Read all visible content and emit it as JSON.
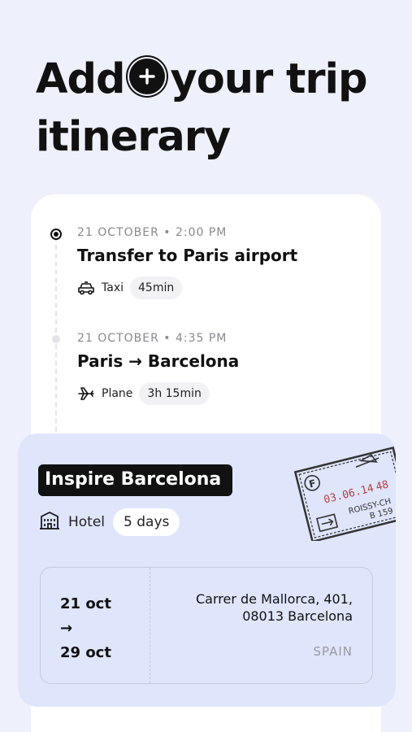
{
  "headline": {
    "line1_before": "Add",
    "line1_after": "your trip",
    "line2": "itinerary",
    "icon": "plus-circle-icon"
  },
  "timeline": [
    {
      "date": "21 OCTOBER • 2:00 PM",
      "title": "Transfer to Paris airport",
      "mode_icon": "taxi-icon",
      "mode": "Taxi",
      "duration": "45min"
    },
    {
      "date": "21 OCTOBER • 4:35 PM",
      "title": "Paris → Barcelona",
      "mode_icon": "plane-icon",
      "mode": "Plane",
      "duration": "3h 15min"
    }
  ],
  "hotel": {
    "name": "Inspire Barcelona",
    "type_icon": "hotel-icon",
    "type": "Hotel",
    "stay": "5 days",
    "check_in": "21 oct",
    "arrow": "→",
    "check_out": "29 oct",
    "address_line1": "Carrer de Mallorca, 401,",
    "address_line2": "08013 Barcelona",
    "country": "SPAIN"
  },
  "stamp": {
    "date": "03.06.14",
    "number": "48",
    "place": "ROISSY-CH",
    "code": "B 159",
    "letter": "F"
  },
  "colors": {
    "background": "#eef0fb",
    "hotel_card": "#dfe5fb",
    "ink": "#111111",
    "stamp_red": "#b0413e"
  }
}
